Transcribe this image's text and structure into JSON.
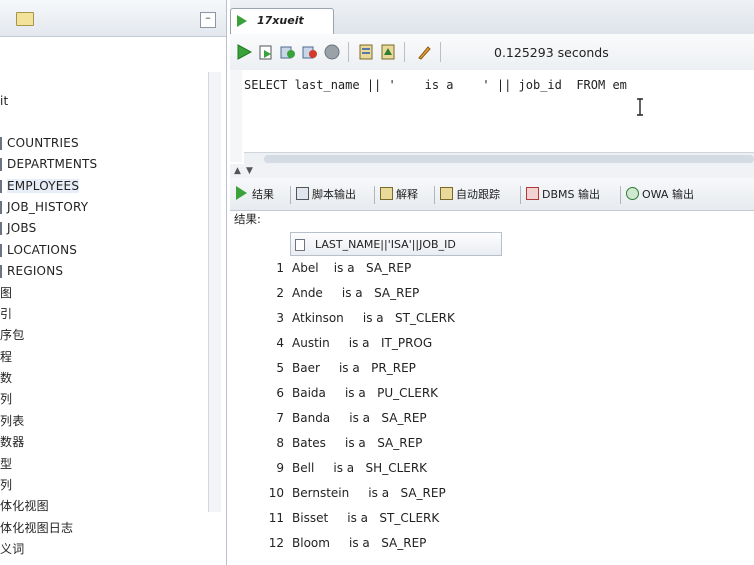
{
  "navigator": {
    "partial_top_label": "it",
    "tables": [
      {
        "label": "COUNTRIES"
      },
      {
        "label": "DEPARTMENTS"
      },
      {
        "label": "EMPLOYEES"
      },
      {
        "label": "JOB_HISTORY"
      },
      {
        "label": "JOBS"
      },
      {
        "label": "LOCATIONS"
      },
      {
        "label": "REGIONS"
      }
    ],
    "other_nodes": [
      {
        "label": "图"
      },
      {
        "label": "引"
      },
      {
        "label": "序包"
      },
      {
        "label": "程"
      },
      {
        "label": "数"
      },
      {
        "label": "列"
      },
      {
        "label": "列表"
      },
      {
        "label": "数器"
      },
      {
        "label": "型"
      },
      {
        "label": "列"
      },
      {
        "label": "体化视图"
      },
      {
        "label": "体化视图日志"
      },
      {
        "label": "义词"
      }
    ]
  },
  "editor": {
    "tab_title": "17xueit",
    "elapsed": "0.125293 seconds",
    "sql": "SELECT last_name || '    is a    ' || job_id  FROM em"
  },
  "result_tabs": [
    {
      "label": "结果",
      "icon": "play-icon"
    },
    {
      "label": "脚本输出",
      "icon": "script-output-icon"
    },
    {
      "label": "解释",
      "icon": "explain-icon"
    },
    {
      "label": "自动跟踪",
      "icon": "autotrace-icon"
    },
    {
      "label": "DBMS 输出",
      "icon": "dbms-output-icon"
    },
    {
      "label": "OWA 输出",
      "icon": "owa-output-icon"
    }
  ],
  "result": {
    "label": "结果:",
    "column_header": "LAST_NAME||'ISA'||JOB_ID",
    "rows": [
      {
        "num": "1",
        "value": "Abel    is a   SA_REP"
      },
      {
        "num": "2",
        "value": "Ande     is a   SA_REP"
      },
      {
        "num": "3",
        "value": "Atkinson     is a   ST_CLERK"
      },
      {
        "num": "4",
        "value": "Austin     is a   IT_PROG"
      },
      {
        "num": "5",
        "value": "Baer     is a   PR_REP"
      },
      {
        "num": "6",
        "value": "Baida     is a   PU_CLERK"
      },
      {
        "num": "7",
        "value": "Banda     is a   SA_REP"
      },
      {
        "num": "8",
        "value": "Bates     is a   SA_REP"
      },
      {
        "num": "9",
        "value": "Bell     is a   SH_CLERK"
      },
      {
        "num": "10",
        "value": "Bernstein     is a   SA_REP"
      },
      {
        "num": "11",
        "value": "Bisset     is a   ST_CLERK"
      },
      {
        "num": "12",
        "value": "Bloom     is a   SA_REP"
      }
    ]
  },
  "colors": {
    "run_green": "#3aa23a",
    "selection": "#e8eef8",
    "border": "#b6bec8"
  }
}
